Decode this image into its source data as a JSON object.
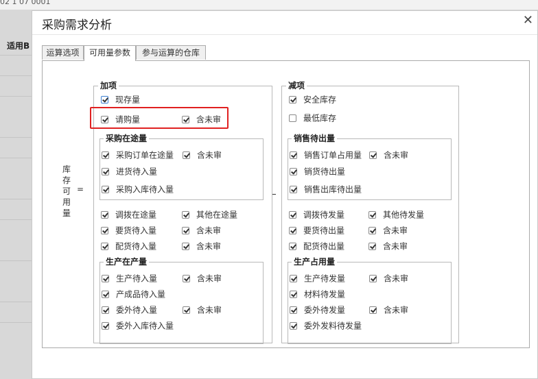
{
  "background": {
    "label": "适用B",
    "date_fragment": "02 1 07 0001"
  },
  "dialog": {
    "title": "采购需求分析",
    "close_glyph": "✕"
  },
  "tabs": [
    {
      "label": "运算选项",
      "active": false
    },
    {
      "label": "可用量参数",
      "active": true
    },
    {
      "label": "参与运算的仓库",
      "active": false
    }
  ],
  "formula": {
    "vertical_label": [
      "库",
      "存",
      "可",
      "用",
      "量"
    ],
    "equals": "="
  },
  "add": {
    "legend": "加项",
    "onhand": {
      "label": "现存量",
      "checked": true
    },
    "requisition": {
      "label": "请购量",
      "checked": true,
      "unaudited": {
        "label": "含未审",
        "checked": true
      }
    },
    "purchase_in_transit": {
      "legend": "采购在途量",
      "po_in_transit": {
        "label": "采购订单在途量",
        "checked": true,
        "unaudited": {
          "label": "含未审",
          "checked": true
        }
      },
      "incoming": {
        "label": "进货待入量",
        "checked": true
      },
      "purchase_receipt": {
        "label": "采购入库待入量",
        "checked": true
      }
    },
    "transfer_in_transit": {
      "label": "调拨在途量",
      "checked": true
    },
    "other_in_transit": {
      "label": "其他在途量",
      "checked": true
    },
    "request_incoming": {
      "label": "要货待入量",
      "checked": true,
      "unaudited": {
        "label": "含未审",
        "checked": true
      }
    },
    "distribution_incoming": {
      "label": "配货待入量",
      "checked": true,
      "unaudited": {
        "label": "含未审",
        "checked": true
      }
    },
    "production_in_process": {
      "legend": "生产在产量",
      "production_incoming": {
        "label": "生产待入量",
        "checked": true,
        "unaudited": {
          "label": "含未审",
          "checked": true
        }
      },
      "finished_incoming": {
        "label": "产成品待入量",
        "checked": true
      },
      "outsource_incoming": {
        "label": "委外待入量",
        "checked": true,
        "unaudited": {
          "label": "含未审",
          "checked": true
        }
      },
      "outsource_receipt": {
        "label": "委外入库待入量",
        "checked": true
      }
    }
  },
  "subtract": {
    "legend": "减项",
    "safety_stock": {
      "label": "安全库存",
      "checked": true
    },
    "min_stock": {
      "label": "最低库存",
      "checked": false
    },
    "sales_pending": {
      "legend": "销售待出量",
      "so_occupied": {
        "label": "销售订单占用量",
        "checked": true,
        "unaudited": {
          "label": "含未审",
          "checked": true
        }
      },
      "delivery_pending": {
        "label": "销货待出量",
        "checked": true
      },
      "sales_outbound": {
        "label": "销售出库待出量",
        "checked": true
      }
    },
    "transfer_pending": {
      "label": "调拨待发量",
      "checked": true
    },
    "other_pending": {
      "label": "其他待发量",
      "checked": true
    },
    "request_pending": {
      "label": "要货待出量",
      "checked": true,
      "unaudited": {
        "label": "含未审",
        "checked": true
      }
    },
    "distribution_pending": {
      "label": "配货待出量",
      "checked": true,
      "unaudited": {
        "label": "含未审",
        "checked": true
      }
    },
    "production_usage": {
      "legend": "生产占用量",
      "production_pending": {
        "label": "生产待发量",
        "checked": true,
        "unaudited": {
          "label": "含未审",
          "checked": true
        }
      },
      "material_pending": {
        "label": "材料待发量",
        "checked": true
      },
      "outsource_pending": {
        "label": "委外待发量",
        "checked": true,
        "unaudited": {
          "label": "含未审",
          "checked": true
        }
      },
      "outsource_material_pending": {
        "label": "委外发料待发量",
        "checked": true
      }
    }
  },
  "colors": {
    "highlight_border": "#e02020",
    "focus_checkbox": "#3c7fd1"
  }
}
